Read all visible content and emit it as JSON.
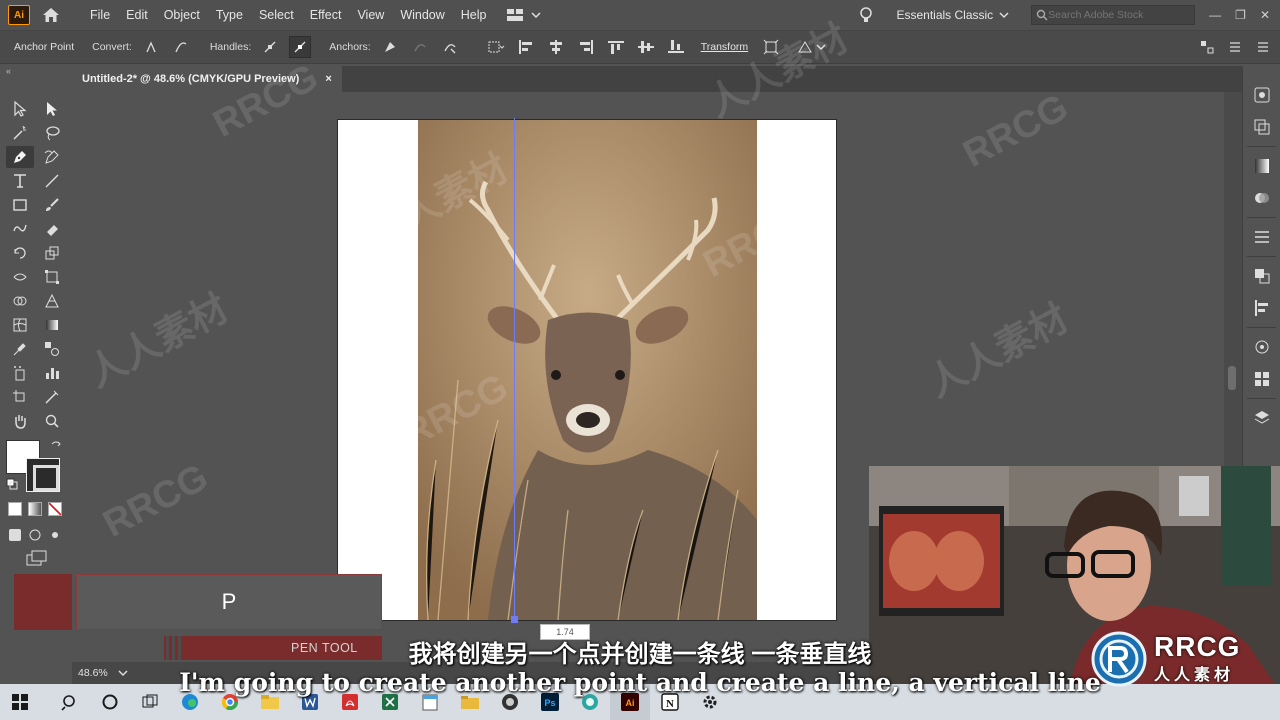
{
  "app": {
    "logo": "Ai",
    "name": "Adobe Illustrator"
  },
  "menu": [
    "File",
    "Edit",
    "Object",
    "Type",
    "Select",
    "Effect",
    "View",
    "Window",
    "Help"
  ],
  "workspace": "Essentials Classic",
  "search": {
    "placeholder": "Search Adobe Stock"
  },
  "controlbar": {
    "tool_label": "Anchor Point",
    "convert_label": "Convert:",
    "handles_label": "Handles:",
    "anchors_label": "Anchors:",
    "transform_label": "Transform"
  },
  "document_tab": {
    "title": "Untitled-2* @ 48.6% (CMYK/GPU Preview)",
    "close": "×"
  },
  "status": {
    "zoom": "48.6%"
  },
  "keystroke": {
    "key": "P",
    "tool_name": "PEN TOOL"
  },
  "measure_tooltip": "1.74",
  "subtitles": {
    "chinese": "我将创建另一个点并创建一条线 一条垂直线",
    "english": "I'm going to create another point and create a line, a vertical line"
  },
  "brand": {
    "name": "RRCG",
    "sub": "人人素材"
  },
  "watermarks": [
    "RRCG",
    "人人素材"
  ],
  "colors": {
    "accent": "#7a2b2b",
    "guide": "#6f7cf5",
    "ai_orange": "#ff9a00"
  }
}
